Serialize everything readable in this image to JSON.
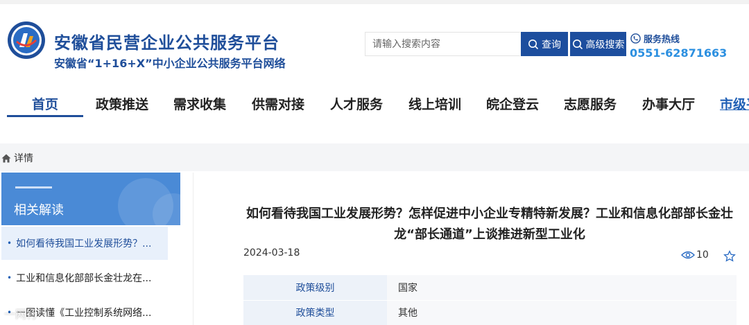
{
  "header": {
    "title": "安徽省民营企业公共服务平台",
    "subtitle": "安徽省“1+16+X”中小企业公共服务平台网络",
    "search_placeholder": "请输入搜索内容",
    "search_button": "查询",
    "advanced_search_button": "高级搜索",
    "hotline_label": "服务热线",
    "hotline_number": "0551-62871663"
  },
  "nav": {
    "items": [
      "首页",
      "政策推送",
      "需求收集",
      "供需对接",
      "人才服务",
      "线上培训",
      "皖企登云",
      "志愿服务",
      "办事大厅",
      "市级平"
    ],
    "active_index": 0
  },
  "breadcrumb": {
    "current": "详情"
  },
  "sidebar": {
    "title": "相关解读",
    "items": [
      "如何看待我国工业发展形势？...",
      "工业和信息化部部长金壮龙在...",
      "一图读懂《工业控制系统网络..."
    ]
  },
  "article": {
    "title": "如何看待我国工业发展形势？怎样促进中小企业专精特新发展？工业和信息化部部长金壮龙“部长通道”上谈推进新型工业化",
    "date": "2024-03-18",
    "views": "10",
    "info": [
      {
        "key": "政策级别",
        "value": "国家"
      },
      {
        "key": "政策类型",
        "value": "其他"
      }
    ]
  },
  "watermark": "一网行",
  "colors": {
    "brand": "#1f4e9a",
    "button": "#1d4e9e",
    "hotline": "#2b8fe0",
    "sidebar_header": "#4a8ad6"
  }
}
